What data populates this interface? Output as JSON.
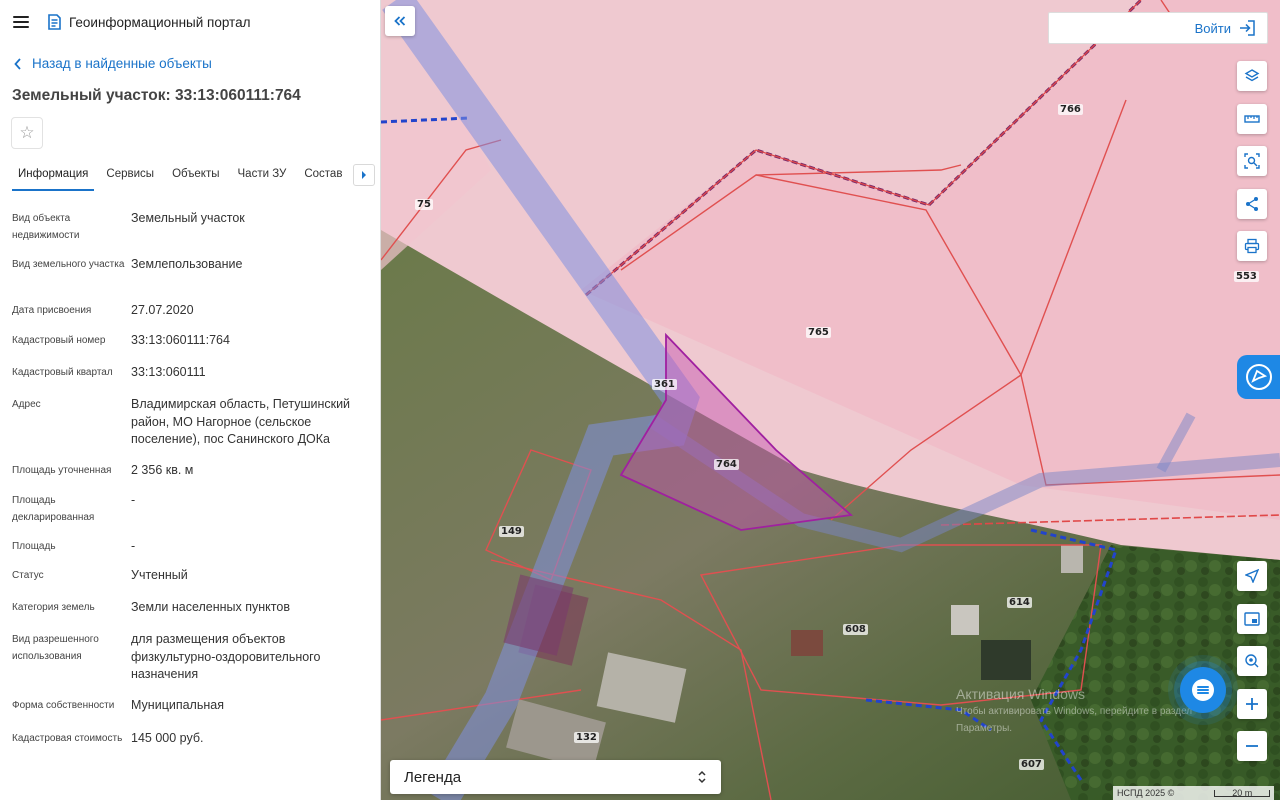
{
  "app": {
    "title": "Геоинформационный портал"
  },
  "nav": {
    "back_label": "Назад в найденные объекты"
  },
  "object": {
    "title": "Земельный участок: 33:13:060111:764"
  },
  "tabs": [
    "Информация",
    "Сервисы",
    "Объекты",
    "Части ЗУ",
    "Состав"
  ],
  "properties": [
    {
      "label": "Вид объекта недвижимости",
      "value": "Земельный участок"
    },
    {
      "label": "Вид земельного участка",
      "value": "Землепользование"
    },
    {
      "label": "Дата присвоения",
      "value": "27.07.2020"
    },
    {
      "label": "Кадастровый номер",
      "value": "33:13:060111:764"
    },
    {
      "label": "Кадастровый квартал",
      "value": "33:13:060111"
    },
    {
      "label": "Адрес",
      "value": "Владимирская область, Петушинский район, МО Нагорное (сельское поселение), пос Санинского ДОКа"
    },
    {
      "label": "Площадь уточненная",
      "value": "2 356 кв. м"
    },
    {
      "label": "Площадь декларированная",
      "value": "-"
    },
    {
      "label": "Площадь",
      "value": "-"
    },
    {
      "label": "Статус",
      "value": "Учтенный"
    },
    {
      "label": "Категория земель",
      "value": "Земли населенных пунктов"
    },
    {
      "label": "Вид разрешенного использования",
      "value": "для размещения объектов физкультурно-оздоровительного назначения"
    },
    {
      "label": "Форма собственности",
      "value": "Муниципальная"
    },
    {
      "label": "Кадастровая стоимость",
      "value": "145 000 руб."
    }
  ],
  "map": {
    "login_label": "Войти",
    "legend_label": "Легенда",
    "parcel_labels": [
      "766",
      "75",
      "553",
      "765",
      "361",
      "764",
      "149",
      "614",
      "608",
      "132",
      "607"
    ],
    "watermark_title": "Активация Windows",
    "watermark_sub": "Чтобы активировать Windows, перейдите в раздел Параметры.",
    "attribution": "НСПД 2025 ©",
    "scale_label": "20 m"
  },
  "colors": {
    "accent": "#1a73c9",
    "parcel_fill": "#f2c4cf",
    "parcel_border": "#e04848",
    "selected": "#a020a0"
  },
  "icons": [
    "menu-icon",
    "portal-logo-icon",
    "chevron-left-icon",
    "star-icon",
    "chevron-right-icon",
    "double-chevron-left-icon",
    "login-icon",
    "layers-icon",
    "ruler-icon",
    "area-select-icon",
    "share-icon",
    "print-icon",
    "nspd-logo-icon",
    "locate-icon",
    "minimap-icon",
    "geolocation-icon",
    "chat-icon",
    "plus-icon",
    "minus-icon",
    "sort-icon"
  ]
}
